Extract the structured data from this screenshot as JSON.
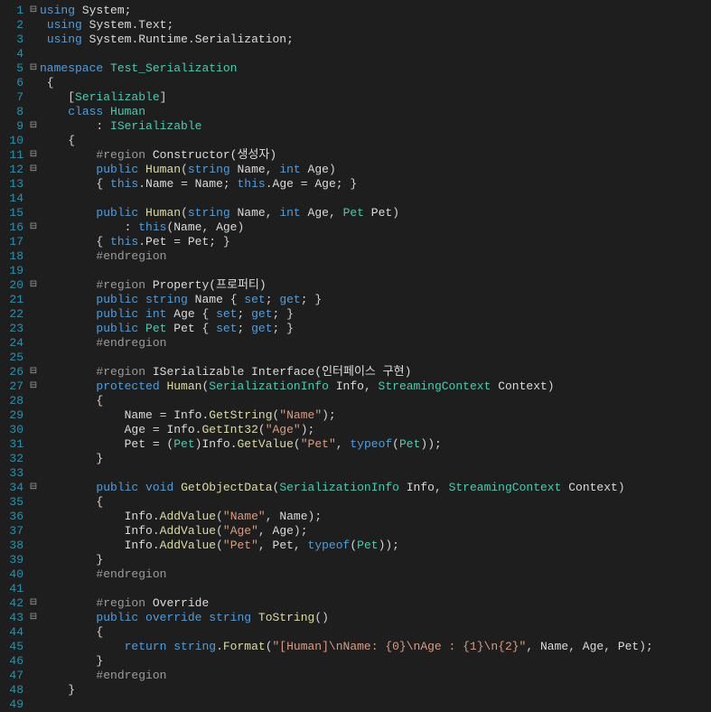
{
  "lines": [
    {
      "n": 1,
      "fold": "⊟",
      "tokens": [
        [
          "kw",
          "using"
        ],
        [
          "pn",
          " "
        ],
        [
          "id",
          "System"
        ],
        [
          "pn",
          ";"
        ]
      ]
    },
    {
      "n": 2,
      "fold": "",
      "tokens": [
        [
          "pn",
          " "
        ],
        [
          "kw",
          "using"
        ],
        [
          "pn",
          " "
        ],
        [
          "id",
          "System"
        ],
        [
          "pn",
          "."
        ],
        [
          "id",
          "Text"
        ],
        [
          "pn",
          ";"
        ]
      ]
    },
    {
      "n": 3,
      "fold": "",
      "tokens": [
        [
          "pn",
          " "
        ],
        [
          "kw",
          "using"
        ],
        [
          "pn",
          " "
        ],
        [
          "id",
          "System"
        ],
        [
          "pn",
          "."
        ],
        [
          "id",
          "Runtime"
        ],
        [
          "pn",
          "."
        ],
        [
          "id",
          "Serialization"
        ],
        [
          "pn",
          ";"
        ]
      ]
    },
    {
      "n": 4,
      "fold": "",
      "tokens": []
    },
    {
      "n": 5,
      "fold": "⊟",
      "tokens": [
        [
          "kw",
          "namespace"
        ],
        [
          "pn",
          " "
        ],
        [
          "cls",
          "Test_Serialization"
        ]
      ]
    },
    {
      "n": 6,
      "fold": "",
      "tokens": [
        [
          "pn",
          " {"
        ]
      ]
    },
    {
      "n": 7,
      "fold": "",
      "tokens": [
        [
          "pn",
          "    ["
        ],
        [
          "cls",
          "Serializable"
        ],
        [
          "pn",
          "]"
        ]
      ]
    },
    {
      "n": 8,
      "fold": "",
      "tokens": [
        [
          "pn",
          "    "
        ],
        [
          "kw",
          "class"
        ],
        [
          "pn",
          " "
        ],
        [
          "cls",
          "Human"
        ]
      ]
    },
    {
      "n": 9,
      "fold": "⊟",
      "tokens": [
        [
          "pn",
          "        : "
        ],
        [
          "cls",
          "ISerializable"
        ]
      ]
    },
    {
      "n": 10,
      "fold": "",
      "tokens": [
        [
          "pn",
          "    {"
        ]
      ]
    },
    {
      "n": 11,
      "fold": "⊟",
      "tokens": [
        [
          "pn",
          "        "
        ],
        [
          "reg",
          "#region"
        ],
        [
          "pn",
          " "
        ],
        [
          "id",
          "Constructor(생성자)"
        ]
      ]
    },
    {
      "n": 12,
      "fold": "⊟",
      "tokens": [
        [
          "pn",
          "        "
        ],
        [
          "kw",
          "public"
        ],
        [
          "pn",
          " "
        ],
        [
          "fn",
          "Human"
        ],
        [
          "pn",
          "("
        ],
        [
          "kw",
          "string"
        ],
        [
          "pn",
          " "
        ],
        [
          "id",
          "Name"
        ],
        [
          "pn",
          ", "
        ],
        [
          "kw",
          "int"
        ],
        [
          "pn",
          " "
        ],
        [
          "id",
          "Age"
        ],
        [
          "pn",
          ")"
        ]
      ]
    },
    {
      "n": 13,
      "fold": "",
      "tokens": [
        [
          "pn",
          "        { "
        ],
        [
          "kw",
          "this"
        ],
        [
          "pn",
          "."
        ],
        [
          "id",
          "Name"
        ],
        [
          "pn",
          " = "
        ],
        [
          "id",
          "Name"
        ],
        [
          "pn",
          "; "
        ],
        [
          "kw",
          "this"
        ],
        [
          "pn",
          "."
        ],
        [
          "id",
          "Age"
        ],
        [
          "pn",
          " = "
        ],
        [
          "id",
          "Age"
        ],
        [
          "pn",
          "; }"
        ]
      ]
    },
    {
      "n": 14,
      "fold": "",
      "tokens": []
    },
    {
      "n": 15,
      "fold": "",
      "tokens": [
        [
          "pn",
          "        "
        ],
        [
          "kw",
          "public"
        ],
        [
          "pn",
          " "
        ],
        [
          "fn",
          "Human"
        ],
        [
          "pn",
          "("
        ],
        [
          "kw",
          "string"
        ],
        [
          "pn",
          " "
        ],
        [
          "id",
          "Name"
        ],
        [
          "pn",
          ", "
        ],
        [
          "kw",
          "int"
        ],
        [
          "pn",
          " "
        ],
        [
          "id",
          "Age"
        ],
        [
          "pn",
          ", "
        ],
        [
          "cls",
          "Pet"
        ],
        [
          "pn",
          " "
        ],
        [
          "id",
          "Pet"
        ],
        [
          "pn",
          ")"
        ]
      ]
    },
    {
      "n": 16,
      "fold": "⊟",
      "tokens": [
        [
          "pn",
          "            : "
        ],
        [
          "kw",
          "this"
        ],
        [
          "pn",
          "("
        ],
        [
          "id",
          "Name"
        ],
        [
          "pn",
          ", "
        ],
        [
          "id",
          "Age"
        ],
        [
          "pn",
          ")"
        ]
      ]
    },
    {
      "n": 17,
      "fold": "",
      "tokens": [
        [
          "pn",
          "        { "
        ],
        [
          "kw",
          "this"
        ],
        [
          "pn",
          "."
        ],
        [
          "id",
          "Pet"
        ],
        [
          "pn",
          " = "
        ],
        [
          "id",
          "Pet"
        ],
        [
          "pn",
          "; }"
        ]
      ]
    },
    {
      "n": 18,
      "fold": "",
      "tokens": [
        [
          "pn",
          "        "
        ],
        [
          "reg",
          "#endregion"
        ]
      ]
    },
    {
      "n": 19,
      "fold": "",
      "tokens": []
    },
    {
      "n": 20,
      "fold": "⊟",
      "tokens": [
        [
          "pn",
          "        "
        ],
        [
          "reg",
          "#region"
        ],
        [
          "pn",
          " "
        ],
        [
          "id",
          "Property(프로퍼티)"
        ]
      ]
    },
    {
      "n": 21,
      "fold": "",
      "tokens": [
        [
          "pn",
          "        "
        ],
        [
          "kw",
          "public"
        ],
        [
          "pn",
          " "
        ],
        [
          "kw",
          "string"
        ],
        [
          "pn",
          " "
        ],
        [
          "id",
          "Name"
        ],
        [
          "pn",
          " { "
        ],
        [
          "kw",
          "set"
        ],
        [
          "pn",
          "; "
        ],
        [
          "kw",
          "get"
        ],
        [
          "pn",
          "; }"
        ]
      ]
    },
    {
      "n": 22,
      "fold": "",
      "tokens": [
        [
          "pn",
          "        "
        ],
        [
          "kw",
          "public"
        ],
        [
          "pn",
          " "
        ],
        [
          "kw",
          "int"
        ],
        [
          "pn",
          " "
        ],
        [
          "id",
          "Age"
        ],
        [
          "pn",
          " { "
        ],
        [
          "kw",
          "set"
        ],
        [
          "pn",
          "; "
        ],
        [
          "kw",
          "get"
        ],
        [
          "pn",
          "; }"
        ]
      ]
    },
    {
      "n": 23,
      "fold": "",
      "tokens": [
        [
          "pn",
          "        "
        ],
        [
          "kw",
          "public"
        ],
        [
          "pn",
          " "
        ],
        [
          "cls",
          "Pet"
        ],
        [
          "pn",
          " "
        ],
        [
          "id",
          "Pet"
        ],
        [
          "pn",
          " { "
        ],
        [
          "kw",
          "set"
        ],
        [
          "pn",
          "; "
        ],
        [
          "kw",
          "get"
        ],
        [
          "pn",
          "; }"
        ]
      ]
    },
    {
      "n": 24,
      "fold": "",
      "tokens": [
        [
          "pn",
          "        "
        ],
        [
          "reg",
          "#endregion"
        ]
      ]
    },
    {
      "n": 25,
      "fold": "",
      "tokens": []
    },
    {
      "n": 26,
      "fold": "⊟",
      "tokens": [
        [
          "pn",
          "        "
        ],
        [
          "reg",
          "#region"
        ],
        [
          "pn",
          " "
        ],
        [
          "id",
          "ISerializable Interface(인터페이스 구현)"
        ]
      ]
    },
    {
      "n": 27,
      "fold": "⊟",
      "tokens": [
        [
          "pn",
          "        "
        ],
        [
          "kw",
          "protected"
        ],
        [
          "pn",
          " "
        ],
        [
          "fn",
          "Human"
        ],
        [
          "pn",
          "("
        ],
        [
          "cls",
          "SerializationInfo"
        ],
        [
          "pn",
          " "
        ],
        [
          "id",
          "Info"
        ],
        [
          "pn",
          ", "
        ],
        [
          "cls",
          "StreamingContext"
        ],
        [
          "pn",
          " "
        ],
        [
          "id",
          "Context"
        ],
        [
          "pn",
          ")"
        ]
      ]
    },
    {
      "n": 28,
      "fold": "",
      "tokens": [
        [
          "pn",
          "        {"
        ]
      ]
    },
    {
      "n": 29,
      "fold": "",
      "tokens": [
        [
          "pn",
          "            "
        ],
        [
          "id",
          "Name"
        ],
        [
          "pn",
          " = "
        ],
        [
          "id",
          "Info"
        ],
        [
          "pn",
          "."
        ],
        [
          "fn",
          "GetString"
        ],
        [
          "pn",
          "("
        ],
        [
          "str",
          "\"Name\""
        ],
        [
          "pn",
          ");"
        ]
      ]
    },
    {
      "n": 30,
      "fold": "",
      "tokens": [
        [
          "pn",
          "            "
        ],
        [
          "id",
          "Age"
        ],
        [
          "pn",
          " = "
        ],
        [
          "id",
          "Info"
        ],
        [
          "pn",
          "."
        ],
        [
          "fn",
          "GetInt32"
        ],
        [
          "pn",
          "("
        ],
        [
          "str",
          "\"Age\""
        ],
        [
          "pn",
          ");"
        ]
      ]
    },
    {
      "n": 31,
      "fold": "",
      "tokens": [
        [
          "pn",
          "            "
        ],
        [
          "id",
          "Pet"
        ],
        [
          "pn",
          " = ("
        ],
        [
          "cls",
          "Pet"
        ],
        [
          "pn",
          ")"
        ],
        [
          "id",
          "Info"
        ],
        [
          "pn",
          "."
        ],
        [
          "fn",
          "GetValue"
        ],
        [
          "pn",
          "("
        ],
        [
          "str",
          "\"Pet\""
        ],
        [
          "pn",
          ", "
        ],
        [
          "kw",
          "typeof"
        ],
        [
          "pn",
          "("
        ],
        [
          "cls",
          "Pet"
        ],
        [
          "pn",
          "));"
        ]
      ]
    },
    {
      "n": 32,
      "fold": "",
      "tokens": [
        [
          "pn",
          "        }"
        ]
      ]
    },
    {
      "n": 33,
      "fold": "",
      "tokens": []
    },
    {
      "n": 34,
      "fold": "⊟",
      "tokens": [
        [
          "pn",
          "        "
        ],
        [
          "kw",
          "public"
        ],
        [
          "pn",
          " "
        ],
        [
          "kw",
          "void"
        ],
        [
          "pn",
          " "
        ],
        [
          "fn",
          "GetObjectData"
        ],
        [
          "pn",
          "("
        ],
        [
          "cls",
          "SerializationInfo"
        ],
        [
          "pn",
          " "
        ],
        [
          "id",
          "Info"
        ],
        [
          "pn",
          ", "
        ],
        [
          "cls",
          "StreamingContext"
        ],
        [
          "pn",
          " "
        ],
        [
          "id",
          "Context"
        ],
        [
          "pn",
          ")"
        ]
      ]
    },
    {
      "n": 35,
      "fold": "",
      "tokens": [
        [
          "pn",
          "        {"
        ]
      ]
    },
    {
      "n": 36,
      "fold": "",
      "tokens": [
        [
          "pn",
          "            "
        ],
        [
          "id",
          "Info"
        ],
        [
          "pn",
          "."
        ],
        [
          "fn",
          "AddValue"
        ],
        [
          "pn",
          "("
        ],
        [
          "str",
          "\"Name\""
        ],
        [
          "pn",
          ", "
        ],
        [
          "id",
          "Name"
        ],
        [
          "pn",
          ");"
        ]
      ]
    },
    {
      "n": 37,
      "fold": "",
      "tokens": [
        [
          "pn",
          "            "
        ],
        [
          "id",
          "Info"
        ],
        [
          "pn",
          "."
        ],
        [
          "fn",
          "AddValue"
        ],
        [
          "pn",
          "("
        ],
        [
          "str",
          "\"Age\""
        ],
        [
          "pn",
          ", "
        ],
        [
          "id",
          "Age"
        ],
        [
          "pn",
          ");"
        ]
      ]
    },
    {
      "n": 38,
      "fold": "",
      "tokens": [
        [
          "pn",
          "            "
        ],
        [
          "id",
          "Info"
        ],
        [
          "pn",
          "."
        ],
        [
          "fn",
          "AddValue"
        ],
        [
          "pn",
          "("
        ],
        [
          "str",
          "\"Pet\""
        ],
        [
          "pn",
          ", "
        ],
        [
          "id",
          "Pet"
        ],
        [
          "pn",
          ", "
        ],
        [
          "kw",
          "typeof"
        ],
        [
          "pn",
          "("
        ],
        [
          "cls",
          "Pet"
        ],
        [
          "pn",
          "));"
        ]
      ]
    },
    {
      "n": 39,
      "fold": "",
      "tokens": [
        [
          "pn",
          "        }"
        ]
      ]
    },
    {
      "n": 40,
      "fold": "",
      "tokens": [
        [
          "pn",
          "        "
        ],
        [
          "reg",
          "#endregion"
        ]
      ]
    },
    {
      "n": 41,
      "fold": "",
      "tokens": []
    },
    {
      "n": 42,
      "fold": "⊟",
      "tokens": [
        [
          "pn",
          "        "
        ],
        [
          "reg",
          "#region"
        ],
        [
          "pn",
          " "
        ],
        [
          "id",
          "Override"
        ]
      ]
    },
    {
      "n": 43,
      "fold": "⊟",
      "tokens": [
        [
          "pn",
          "        "
        ],
        [
          "kw",
          "public"
        ],
        [
          "pn",
          " "
        ],
        [
          "kw",
          "override"
        ],
        [
          "pn",
          " "
        ],
        [
          "kw",
          "string"
        ],
        [
          "pn",
          " "
        ],
        [
          "fn",
          "ToString"
        ],
        [
          "pn",
          "()"
        ]
      ]
    },
    {
      "n": 44,
      "fold": "",
      "tokens": [
        [
          "pn",
          "        {"
        ]
      ]
    },
    {
      "n": 45,
      "fold": "",
      "tokens": [
        [
          "pn",
          "            "
        ],
        [
          "kw",
          "return"
        ],
        [
          "pn",
          " "
        ],
        [
          "kw",
          "string"
        ],
        [
          "pn",
          "."
        ],
        [
          "fn",
          "Format"
        ],
        [
          "pn",
          "("
        ],
        [
          "str",
          "\"[Human]\\nName: {0}\\nAge : {1}\\n{2}\""
        ],
        [
          "pn",
          ", "
        ],
        [
          "id",
          "Name"
        ],
        [
          "pn",
          ", "
        ],
        [
          "id",
          "Age"
        ],
        [
          "pn",
          ", "
        ],
        [
          "id",
          "Pet"
        ],
        [
          "pn",
          ");"
        ]
      ]
    },
    {
      "n": 46,
      "fold": "",
      "tokens": [
        [
          "pn",
          "        }"
        ]
      ]
    },
    {
      "n": 47,
      "fold": "",
      "tokens": [
        [
          "pn",
          "        "
        ],
        [
          "reg",
          "#endregion"
        ]
      ]
    },
    {
      "n": 48,
      "fold": "",
      "tokens": [
        [
          "pn",
          "    }"
        ]
      ]
    },
    {
      "n": 49,
      "fold": "",
      "tokens": []
    }
  ]
}
